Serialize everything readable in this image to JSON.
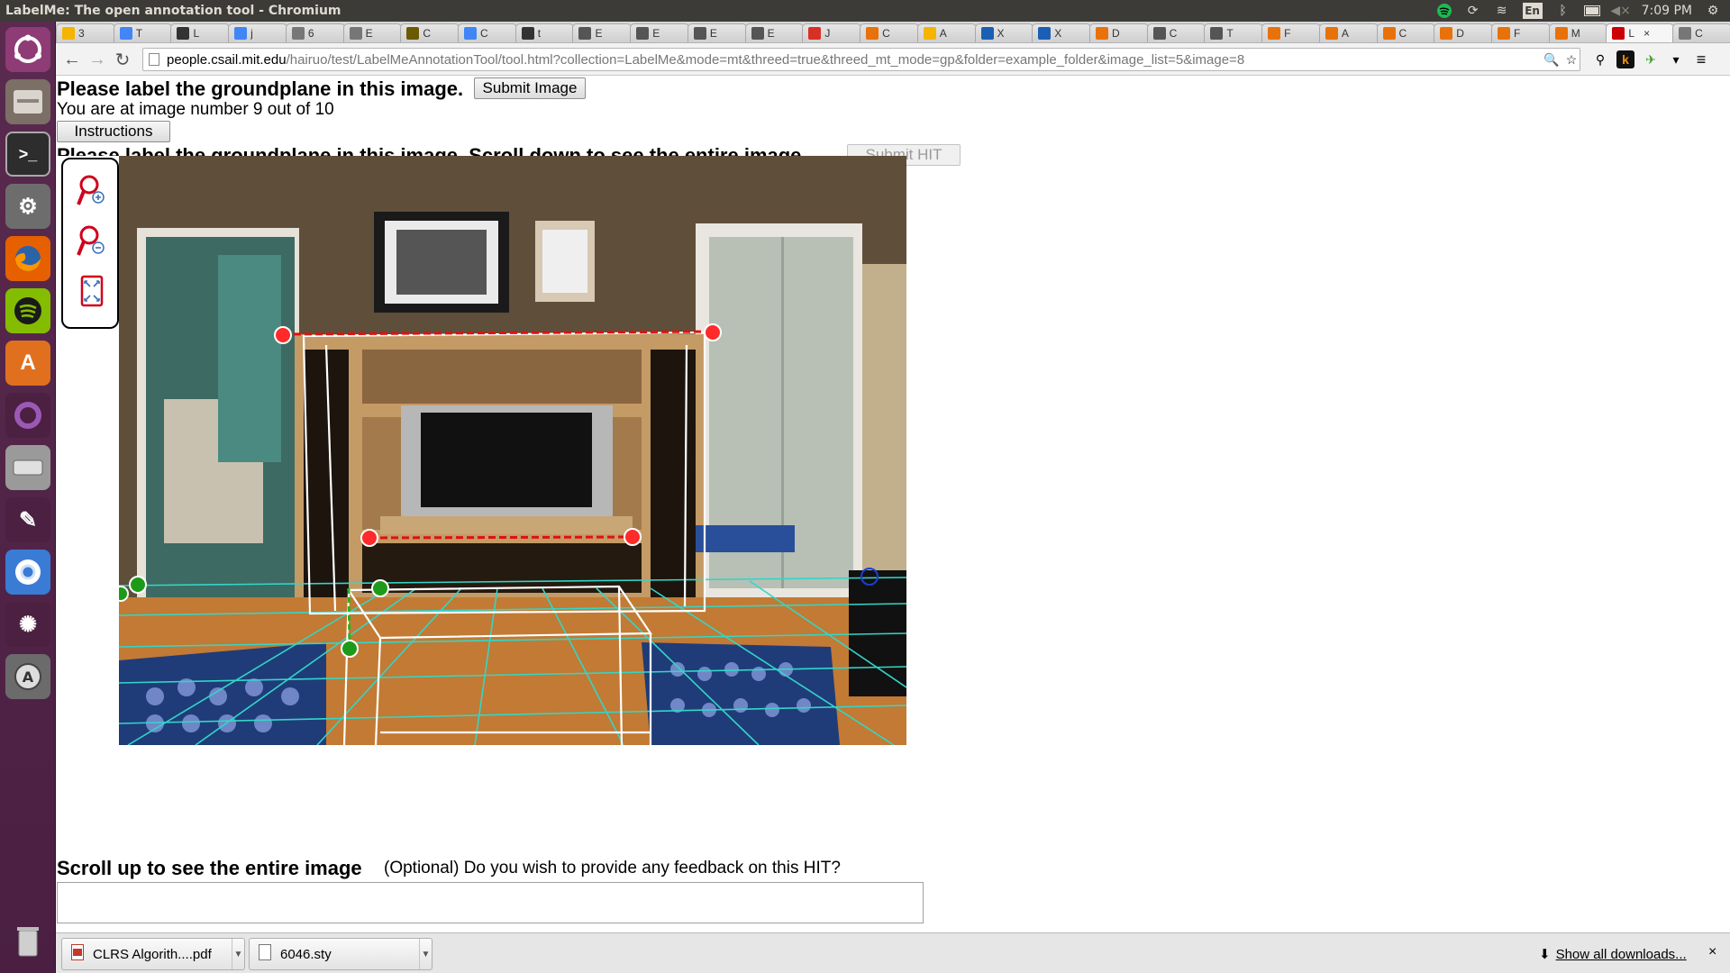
{
  "window": {
    "title": "LabelMe: The open annotation tool - Chromium",
    "clock": "7:09 PM",
    "keyboard": "En"
  },
  "tabs": [
    {
      "label": "3",
      "color": "#f4b400"
    },
    {
      "label": "T",
      "color": "#4285f4"
    },
    {
      "label": "L",
      "color": "#333333"
    },
    {
      "label": "j",
      "color": "#4285f4"
    },
    {
      "label": "6",
      "color": "#777777"
    },
    {
      "label": "E",
      "color": "#777777"
    },
    {
      "label": "C",
      "color": "#6b5a00"
    },
    {
      "label": "C",
      "color": "#4285f4"
    },
    {
      "label": "t",
      "color": "#333333"
    },
    {
      "label": "E",
      "color": "#555555"
    },
    {
      "label": "E",
      "color": "#555555"
    },
    {
      "label": "E",
      "color": "#555555"
    },
    {
      "label": "E",
      "color": "#555555"
    },
    {
      "label": "J",
      "color": "#d93025"
    },
    {
      "label": "C",
      "color": "#e8710a"
    },
    {
      "label": "A",
      "color": "#f4b400"
    },
    {
      "label": "X",
      "color": "#1a5fb4"
    },
    {
      "label": "X",
      "color": "#1a5fb4"
    },
    {
      "label": "D",
      "color": "#e8710a"
    },
    {
      "label": "C",
      "color": "#555555"
    },
    {
      "label": "T",
      "color": "#555555"
    },
    {
      "label": "F",
      "color": "#e8710a"
    },
    {
      "label": "A",
      "color": "#e8710a"
    },
    {
      "label": "C",
      "color": "#e8710a"
    },
    {
      "label": "D",
      "color": "#e8710a"
    },
    {
      "label": "F",
      "color": "#e8710a"
    },
    {
      "label": "M",
      "color": "#e8710a"
    },
    {
      "label": "L",
      "color": "#cc0000",
      "active": true
    },
    {
      "label": "C",
      "color": "#777777"
    }
  ],
  "active_tab_close": "×",
  "address": {
    "domain": "people.csail.mit.edu",
    "path": "/hairuo/test/LabelMeAnnotationTool/tool.html?collection=LabelMe&mode=mt&threed=true&threed_mt_mode=gp&folder=example_folder&image_list=5&image=8"
  },
  "page": {
    "heading": "Please label the groundplane in this image.",
    "submit_image": "Submit Image",
    "progress": "You are at image number 9 out of 10",
    "instructions": "Instructions",
    "heading2": "Please label the groundplane in this image. Scroll down to see the entire image.",
    "submit_hit": "Submit HIT",
    "scroll_up": "Scroll up to see the entire image",
    "feedback_question": "(Optional) Do you wish to provide any feedback on this HIT?",
    "feedback_value": ""
  },
  "downloads": {
    "items": [
      {
        "name": "CLRS Algorith....pdf",
        "icon": "pdf-icon"
      },
      {
        "name": "6046.sty",
        "icon": "file-icon"
      }
    ],
    "show_all": "Show all downloads..."
  },
  "tools": [
    "zoom-in-icon",
    "zoom-out-icon",
    "fit-image-icon"
  ]
}
